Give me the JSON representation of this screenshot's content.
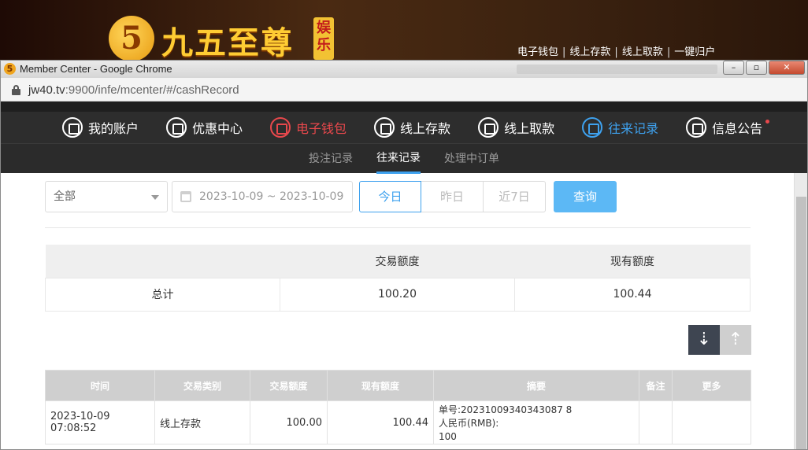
{
  "site": {
    "logo_glyph": "5",
    "logo_text": "九五至尊",
    "logo_badge": "娱乐",
    "links": [
      "电子钱包",
      "线上存款",
      "线上取款",
      "一键归户"
    ]
  },
  "window": {
    "title": "Member Center - Google Chrome",
    "url_host": "jw40.tv",
    "url_rest": ":9900/infe/mcenter/#/cashRecord"
  },
  "nav": {
    "items": [
      {
        "label": "我的账户"
      },
      {
        "label": "优惠中心"
      },
      {
        "label": "电子钱包"
      },
      {
        "label": "线上存款"
      },
      {
        "label": "线上取款"
      },
      {
        "label": "往来记录"
      },
      {
        "label": "信息公告"
      }
    ],
    "active_color": "#3ea1ee",
    "alert_color": "#e8484c"
  },
  "subnav": {
    "tabs": [
      "投注记录",
      "往来记录",
      "处理中订单"
    ],
    "active": "往来记录"
  },
  "filters": {
    "type_value": "全部",
    "date_range": "2023-10-09 ~ 2023-10-09",
    "quick": [
      "今日",
      "昨日",
      "近7日"
    ],
    "search_label": "查询"
  },
  "summary": {
    "headers": [
      "",
      "交易额度",
      "现有额度"
    ],
    "row": [
      "总计",
      "100.20",
      "100.44"
    ]
  },
  "records": {
    "headers": [
      "时间",
      "交易类别",
      "交易额度",
      "现有额度",
      "摘要",
      "备注",
      "更多"
    ],
    "rows": [
      {
        "time": "2023-10-09 07:08:52",
        "type": "线上存款",
        "amount": "100.00",
        "balance": "100.44",
        "summary_line1": "单号:20231009340343087 8",
        "summary_line2": "人民币(RMB):",
        "summary_line3": "100",
        "note": "",
        "more": ""
      }
    ]
  }
}
